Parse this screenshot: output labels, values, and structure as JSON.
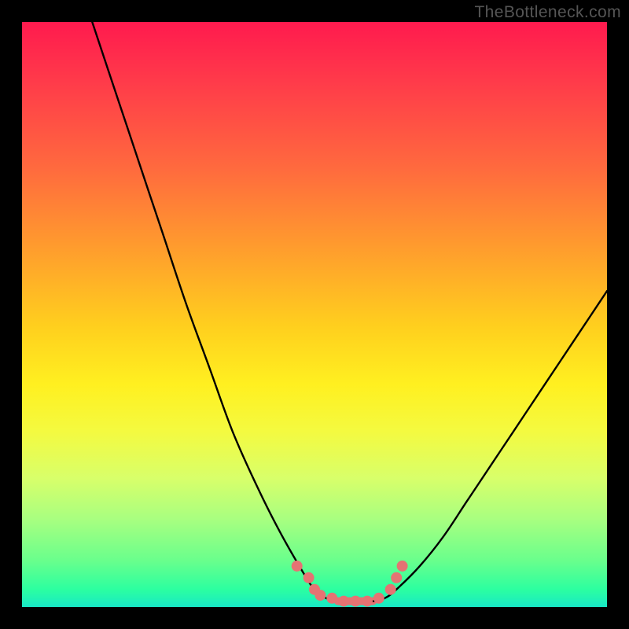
{
  "attribution": "TheBottleneck.com",
  "chart_data": {
    "type": "line",
    "title": "",
    "xlabel": "",
    "ylabel": "",
    "xlim": [
      0,
      100
    ],
    "ylim": [
      0,
      100
    ],
    "grid": false,
    "legend": false,
    "series": [
      {
        "name": "left-curve",
        "x": [
          12,
          16,
          20,
          24,
          28,
          32,
          36,
          40,
          44,
          48,
          50,
          52,
          54
        ],
        "y": [
          100,
          88,
          76,
          64,
          52,
          41,
          30,
          21,
          13,
          6,
          3,
          1.5,
          1
        ]
      },
      {
        "name": "right-curve",
        "x": [
          60,
          62,
          64,
          68,
          72,
          76,
          80,
          84,
          88,
          92,
          96,
          100
        ],
        "y": [
          1,
          1.5,
          3,
          7,
          12,
          18,
          24,
          30,
          36,
          42,
          48,
          54
        ]
      },
      {
        "name": "flat-bottom",
        "x": [
          54,
          60
        ],
        "y": [
          1,
          1
        ]
      }
    ],
    "markers": {
      "name": "highlight-dots",
      "color": "#e57373",
      "points": [
        {
          "x": 47,
          "y": 7
        },
        {
          "x": 49,
          "y": 5
        },
        {
          "x": 50,
          "y": 3
        },
        {
          "x": 51,
          "y": 2
        },
        {
          "x": 53,
          "y": 1.5
        },
        {
          "x": 55,
          "y": 1
        },
        {
          "x": 57,
          "y": 1
        },
        {
          "x": 59,
          "y": 1
        },
        {
          "x": 61,
          "y": 1.5
        },
        {
          "x": 63,
          "y": 3
        },
        {
          "x": 64,
          "y": 5
        },
        {
          "x": 65,
          "y": 7
        }
      ]
    }
  }
}
